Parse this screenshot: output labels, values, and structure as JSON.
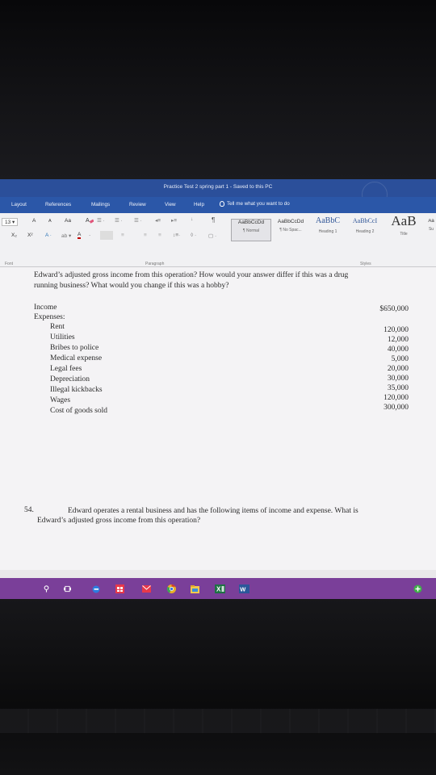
{
  "window": {
    "title": "Practice Test 2 spring part 1  -  Saved to this PC"
  },
  "ribbon_tabs": [
    "Layout",
    "References",
    "Mailings",
    "Review",
    "View",
    "Help"
  ],
  "tell_me": {
    "placeholder": "Tell me what you want to do"
  },
  "font": {
    "size": "13",
    "aa_label": "Aa",
    "grow": "A",
    "shrink": "A",
    "sub": "X₂",
    "sup": "X²"
  },
  "styles": [
    {
      "sample": "AaBbCcDd",
      "name": "¶ Normal"
    },
    {
      "sample": "AaBbCcDd",
      "name": "¶ No Spac..."
    },
    {
      "sample": "AaBbC",
      "name": "Heading 1"
    },
    {
      "sample": "AaBbCcI",
      "name": "Heading 2"
    },
    {
      "sample": "AaB",
      "name": "Title"
    },
    {
      "sample": "Aa",
      "name": "Su"
    }
  ],
  "group_labels": {
    "font": "Font",
    "paragraph": "Paragraph",
    "styles": "Styles"
  },
  "document": {
    "question_line1": "Edward’s adjusted gross income from this operation? How would your answer differ if this was a drug",
    "question_line2": "running business? What would you change if this was a hobby?",
    "income_label": "Income",
    "income_value": "$650,000",
    "expenses_label": "Expenses:",
    "expenses": [
      {
        "label": "Rent",
        "value": "120,000"
      },
      {
        "label": "Utilities",
        "value": "12,000"
      },
      {
        "label": "Bribes to police",
        "value": "40,000"
      },
      {
        "label": "Medical expense",
        "value": "5,000"
      },
      {
        "label": "Legal fees",
        "value": "20,000"
      },
      {
        "label": "Depreciation",
        "value": "30,000"
      },
      {
        "label": "Illegal kickbacks",
        "value": "35,000"
      },
      {
        "label": "Wages",
        "value": "120,000"
      },
      {
        "label": "Cost of goods sold",
        "value": "300,000"
      }
    ],
    "q54_number": "54.",
    "q54_line1": "Edward operates a rental business and has the following items of income and expense. What is",
    "q54_line2": "Edward’s adjusted gross income from this operation?"
  },
  "taskbar_icons": [
    "search-icon",
    "task-view-icon",
    "edge-icon",
    "store-icon",
    "mail-icon",
    "chrome-icon",
    "file-explorer-icon",
    "excel-icon",
    "word-icon",
    "add-icon"
  ],
  "colors": {
    "titlebar": "#2b4f9a",
    "ribbon_tabs": "#2b57a8",
    "taskbar": "#7a3f99",
    "heading_blue": "#2f5597"
  }
}
